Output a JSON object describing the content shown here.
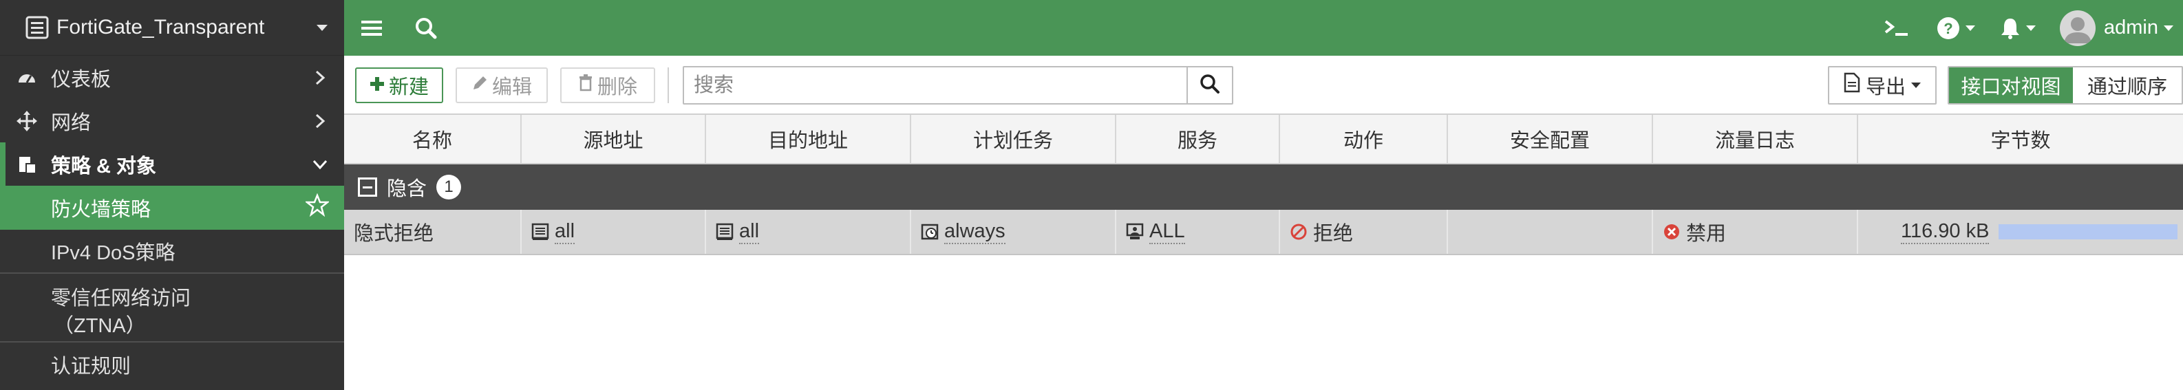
{
  "colors": {
    "brand_green": "#4a9556",
    "sidebar_bg": "#333333",
    "group_bg": "#4a4a4a",
    "deny_red": "#d9433a",
    "bytes_bar": "#b3c8f2"
  },
  "sidebar": {
    "device_name": "FortiGate_Transparent",
    "items": [
      {
        "label": "仪表板",
        "icon": "dashboard-icon"
      },
      {
        "label": "网络",
        "icon": "network-arrows-icon"
      },
      {
        "label": "策略 & 对象",
        "icon": "policy-icon"
      }
    ],
    "sub_items": [
      {
        "label": "防火墙策略"
      },
      {
        "label": "IPv4 DoS策略"
      },
      {
        "label": "零信任网络访问",
        "label2": "（ZTNA）"
      },
      {
        "label": "认证规则"
      }
    ]
  },
  "topbar": {
    "user": "admin",
    "icons": [
      "hamburger-icon",
      "search-icon",
      "cli-icon",
      "help-icon",
      "bell-icon"
    ]
  },
  "toolbar": {
    "new_label": "新建",
    "edit_label": "编辑",
    "delete_label": "删除",
    "search_placeholder": "搜索",
    "export_label": "导出",
    "view_interface_pair": "接口对视图",
    "view_sequence": "通过顺序"
  },
  "table": {
    "columns": [
      "名称",
      "源地址",
      "目的地址",
      "计划任务",
      "服务",
      "动作",
      "安全配置",
      "流量日志",
      "字节数"
    ],
    "group": {
      "label": "隐含",
      "count": "1"
    },
    "rows": [
      {
        "name": "隐式拒绝",
        "src": "all",
        "dst": "all",
        "schedule": "always",
        "service": "ALL",
        "action": "拒绝",
        "security": "",
        "log": "禁用",
        "bytes": "116.90 kB",
        "bytes_fraction": 1.0
      }
    ]
  }
}
